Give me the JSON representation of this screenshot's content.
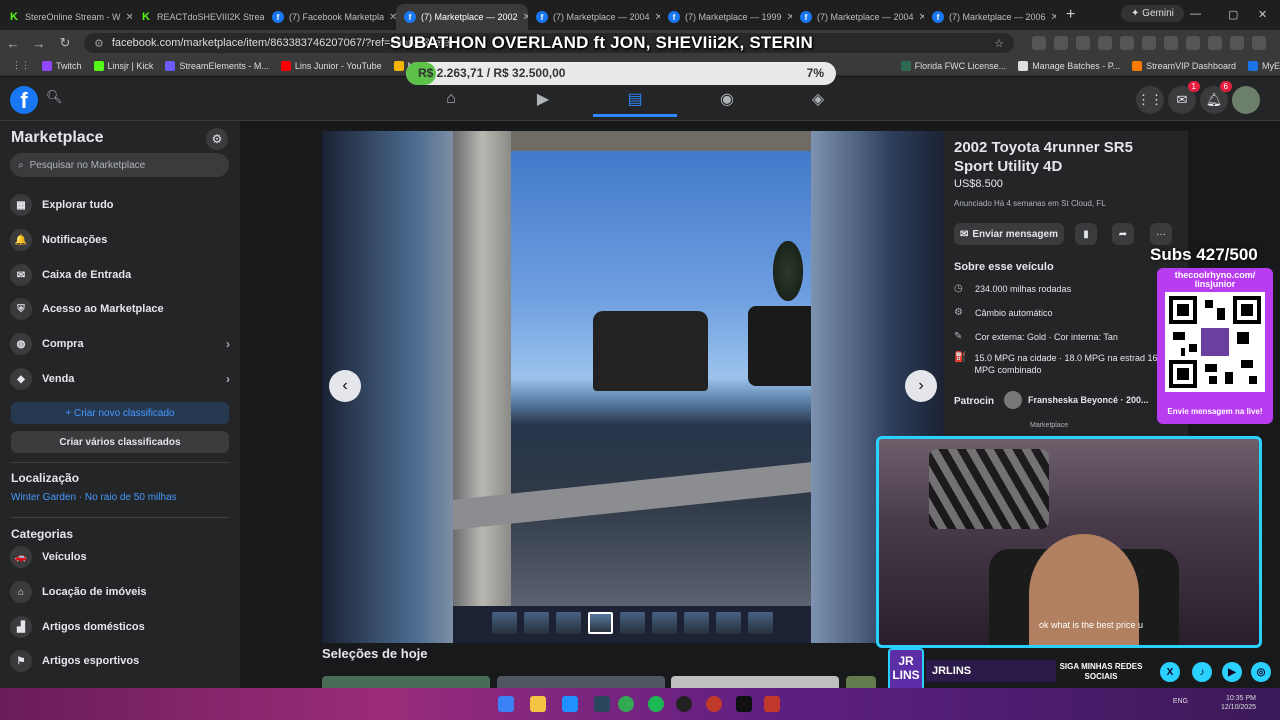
{
  "tabs": [
    {
      "icon": "kick-icon",
      "label": "StereOnline Stream - W"
    },
    {
      "icon": "kick-icon",
      "label": "REACTdoSHEVIII2K Strea"
    },
    {
      "icon": "facebook-icon",
      "label": "(7) Facebook Marketpla"
    },
    {
      "icon": "facebook-icon",
      "label": "(7) Marketplace — 2002"
    },
    {
      "icon": "facebook-icon",
      "label": "(7) Marketplace — 2004"
    },
    {
      "icon": "facebook-icon",
      "label": "(7) Marketplace — 1999"
    },
    {
      "icon": "facebook-icon",
      "label": "(7) Marketplace — 2004"
    },
    {
      "icon": "facebook-icon",
      "label": "(7) Marketplace — 2006"
    }
  ],
  "gemini_label": "Gemini",
  "url": "facebook.com/marketplace/item/863383746207067/?ref=search&refe",
  "bookmarks": [
    {
      "label": "Twitch",
      "color": "#9146ff"
    },
    {
      "label": "Linsjr | Kick",
      "color": "#53fc18"
    },
    {
      "label": "StreamElements - M...",
      "color": "#6a5cff"
    },
    {
      "label": "Lins Junior - YouTube",
      "color": "#ff0000"
    },
    {
      "label": "Meu Drive",
      "color": "#f4b400"
    },
    {
      "label": "Florida FWC License...",
      "color": "#2d6a4f"
    },
    {
      "label": "Manage Batches - P...",
      "color": "#dddddd"
    },
    {
      "label": "StreamVIP Dashboard",
      "color": "#ff7b00"
    },
    {
      "label": "MyEasyGov",
      "color": "#1a73e8"
    }
  ],
  "header": {
    "messenger_badge": "1",
    "notifications_badge": "6"
  },
  "sidebar": {
    "title": "Marketplace",
    "search_placeholder": "Pesquisar no Marketplace",
    "items": [
      {
        "label": "Explorar tudo",
        "icon": "storefront-icon",
        "glyph": "▦"
      },
      {
        "label": "Notificações",
        "icon": "bell-icon",
        "glyph": "🔔"
      },
      {
        "label": "Caixa de Entrada",
        "icon": "messenger-icon",
        "glyph": "✉"
      },
      {
        "label": "Acesso ao Marketplace",
        "icon": "shield-icon",
        "glyph": "⛨"
      },
      {
        "label": "Compra",
        "icon": "shopping-bag-icon",
        "glyph": "◍"
      },
      {
        "label": "Venda",
        "icon": "tag-icon",
        "glyph": "◆"
      }
    ],
    "create_listing": "Criar novo classificado",
    "create_multiple": "Criar vários classificados",
    "location_heading": "Localização",
    "location_value": "Winter Garden · No raio de 50 milhas",
    "categories_heading": "Categorias",
    "categories": [
      {
        "label": "Veículos",
        "icon": "car-icon",
        "glyph": "🚗"
      },
      {
        "label": "Locação de imóveis",
        "icon": "house-icon",
        "glyph": "⌂"
      },
      {
        "label": "Artigos domésticos",
        "icon": "armchair-icon",
        "glyph": "▟"
      },
      {
        "label": "Artigos esportivos",
        "icon": "running-icon",
        "glyph": "⚑"
      }
    ]
  },
  "listing": {
    "title": "2002 Toyota 4runner SR5 Sport Utility 4D",
    "price": "US$8.500",
    "listed": "Anunciado Há 4 semanas em St Cloud, FL",
    "send_message": "Enviar mensagem",
    "about_heading": "Sobre esse veículo",
    "details": [
      {
        "icon": "odometer-icon",
        "glyph": "◷",
        "text": "234.000 milhas rodadas"
      },
      {
        "icon": "gearbox-icon",
        "glyph": "⚙",
        "text": "Câmbio automático"
      },
      {
        "icon": "paint-icon",
        "glyph": "✎",
        "text": "Cor externa: Gold · Cor interna: Tan"
      },
      {
        "icon": "fuel-pump-icon",
        "glyph": "⛽",
        "text": "15.0 MPG na cidade · 18.0 MPG na estrad 16.0 MPG combinado"
      }
    ],
    "sponsored_label": "Patrocin",
    "ad_name": "Fransheska Beyoncé · 200...",
    "ad_source": "Marketplace"
  },
  "photo_count": 9,
  "selected_photo": 4,
  "todays_picks": "Seleções de hoje",
  "overlay": {
    "title": "SUBATHON OVERLAND ft JON, SHEVIii2K, STERIN",
    "goal_text": "R$ 2.263,71 / R$ 32.500,00",
    "goal_percent": "7%",
    "goal_fraction": 0.07,
    "subs": "Subs 427/500",
    "qr_header": "thecoolrhyno.com/ linsjunior",
    "qr_footer": "Envie mensagem na live!",
    "chat_line": "ok what is the best price u",
    "brand_badge": "JR LINS",
    "brand_name": "JRLINS",
    "follow_text": "SIGA MINHAS REDES SOCIAIS"
  },
  "taskbar": {
    "lang": "ENG",
    "time": "10:35 PM",
    "date": "12/10/2025"
  }
}
